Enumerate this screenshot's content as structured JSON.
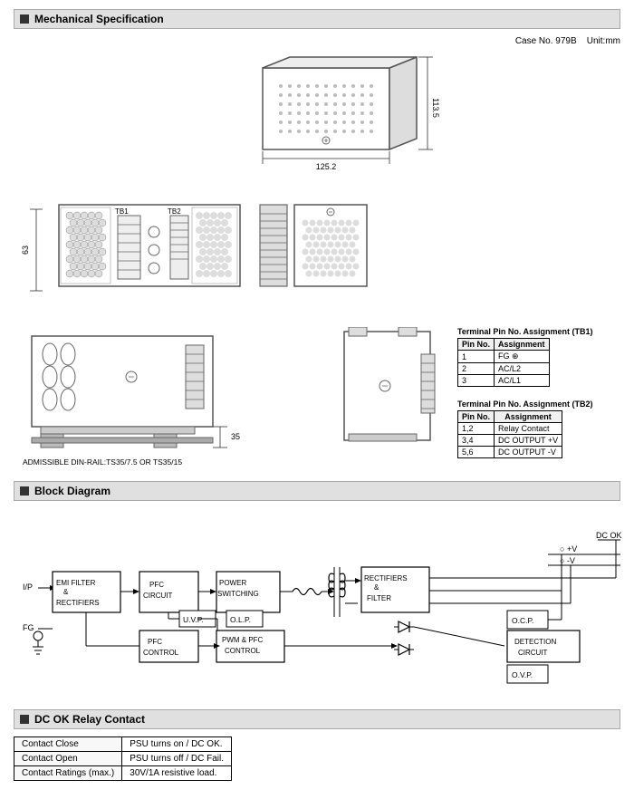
{
  "sections": {
    "mechanical": {
      "title": "Mechanical Specification",
      "case_info": "Case No. 979B",
      "unit": "Unit:mm",
      "dim_width": "125.2",
      "dim_height": "113.5",
      "dim_depth": "63",
      "dim_35": "35",
      "din_rail_text": "ADMISSIBLE DIN-RAIL:TS35/7.5 OR TS35/15",
      "terminal_tb1_title": "Terminal Pin No.  Assignment (TB1)",
      "terminal_tb2_title": "Terminal Pin No.  Assignment (TB2)",
      "tb1_headers": [
        "Pin No.",
        "Assignment"
      ],
      "tb1_rows": [
        [
          "1",
          "FG ⊕"
        ],
        [
          "2",
          "AC/L2"
        ],
        [
          "3",
          "AC/L1"
        ]
      ],
      "tb2_headers": [
        "Pin No.",
        "Assignment"
      ],
      "tb2_rows": [
        [
          "1,2",
          "Relay Contact"
        ],
        [
          "3,4",
          "DC OUTPUT +V"
        ],
        [
          "5,6",
          "DC OUTPUT -V"
        ]
      ]
    },
    "block_diagram": {
      "title": "Block Diagram",
      "nodes": [
        {
          "id": "ip",
          "label": "I/P"
        },
        {
          "id": "fg",
          "label": "FG"
        },
        {
          "id": "emi",
          "label": "EMI FILTER\n& \nRECTIFIERS"
        },
        {
          "id": "pfc_circuit",
          "label": "PFC\nCIRCUIT"
        },
        {
          "id": "power_switching",
          "label": "POWER\nSWITCHING"
        },
        {
          "id": "rectifiers",
          "label": "RECTIFIERS\n&\nFILTER"
        },
        {
          "id": "uvp",
          "label": "U.V.P."
        },
        {
          "id": "olp",
          "label": "O.L.P."
        },
        {
          "id": "pfc_control",
          "label": "PFC\nCONTROL"
        },
        {
          "id": "pwm_pfc",
          "label": "PWM & PFC\nCONTROL"
        },
        {
          "id": "detection",
          "label": "DETECTION\nCIRCUIT"
        },
        {
          "id": "ocp",
          "label": "O.C.P."
        },
        {
          "id": "ovp",
          "label": "O.V.P."
        },
        {
          "id": "dc_ok",
          "label": "DC OK"
        },
        {
          "id": "vpos",
          "label": "+V"
        },
        {
          "id": "vneg",
          "label": "-V"
        }
      ]
    },
    "relay_contact": {
      "title": "DC OK Relay Contact",
      "rows": [
        [
          "Contact Close",
          "PSU turns on / DC OK."
        ],
        [
          "Contact Open",
          "PSU turns off / DC Fail."
        ],
        [
          "Contact Ratings (max.)",
          "30V/1A resistive load."
        ]
      ]
    }
  }
}
